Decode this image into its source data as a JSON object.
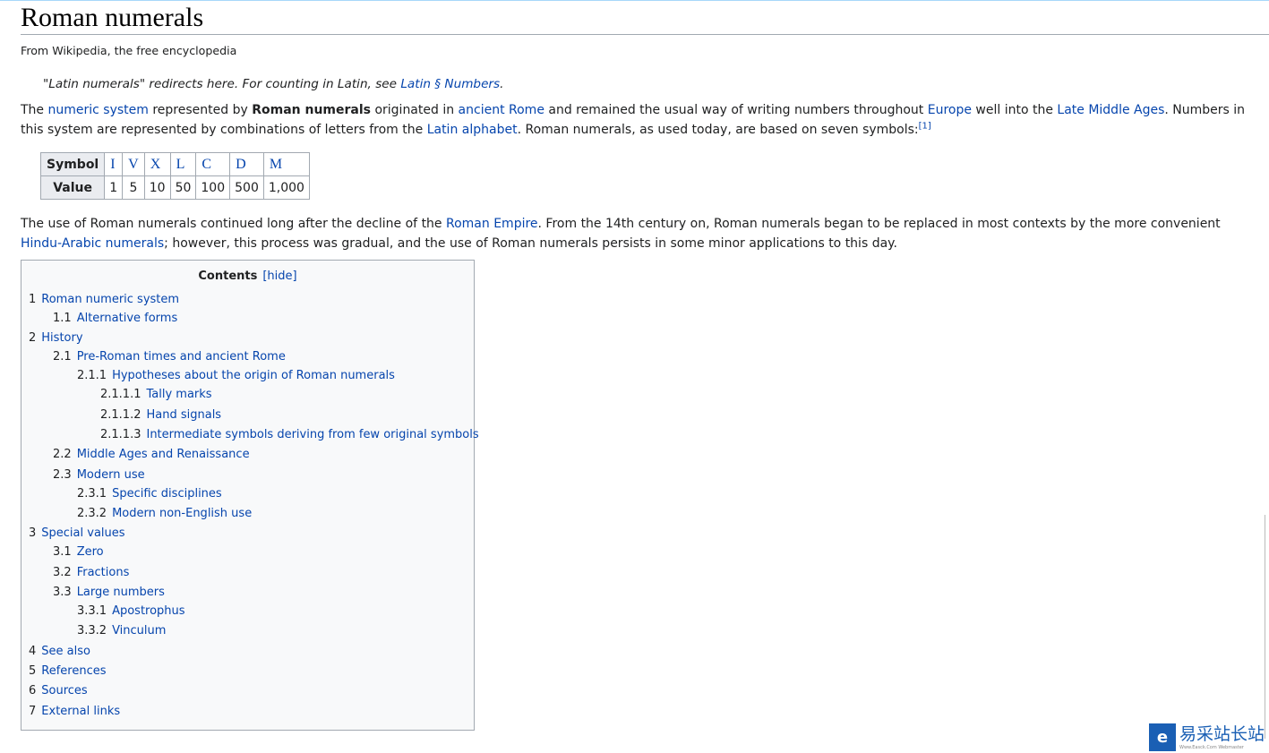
{
  "title": "Roman numerals",
  "tagline": "From Wikipedia, the free encyclopedia",
  "hatnote": {
    "text": "\"Latin numerals\" redirects here. For counting in Latin, see ",
    "link": "Latin § Numbers",
    "end": "."
  },
  "p1": [
    {
      "t": "The "
    },
    {
      "l": "numeric system"
    },
    {
      "t": " represented by "
    },
    {
      "b": "Roman numerals"
    },
    {
      "t": " originated in "
    },
    {
      "l": "ancient Rome"
    },
    {
      "t": " and remained the usual way of writing numbers throughout "
    },
    {
      "l": "Europe"
    },
    {
      "t": " well into the "
    },
    {
      "l": "Late Middle Ages"
    },
    {
      "t": ". Numbers in this system are represented by combinations of letters from the "
    },
    {
      "l": "Latin alphabet"
    },
    {
      "t": ". Roman numerals, as used today, are based on seven symbols:"
    },
    {
      "sup": "[1]"
    }
  ],
  "table": {
    "row_headers": [
      "Symbol",
      "Value"
    ],
    "symbols": [
      "I",
      "V",
      "X",
      "L",
      "C",
      "D",
      "M"
    ],
    "values": [
      "1",
      "5",
      "10",
      "50",
      "100",
      "500",
      "1,000"
    ]
  },
  "p2": [
    {
      "t": "The use of Roman numerals continued long after the decline of the "
    },
    {
      "l": "Roman Empire"
    },
    {
      "t": ". From the 14th century on, Roman numerals began to be replaced in most contexts by the more convenient "
    },
    {
      "l": "Hindu-Arabic numerals"
    },
    {
      "t": "; however, this process was gradual, and the use of Roman numerals persists in some minor applications to this day."
    }
  ],
  "toc": {
    "title": "Contents",
    "hide": "[hide]",
    "items": [
      {
        "n": "1",
        "t": "Roman numeric system",
        "lvl": 1
      },
      {
        "n": "1.1",
        "t": "Alternative forms",
        "lvl": 2
      },
      {
        "n": "2",
        "t": "History",
        "lvl": 1
      },
      {
        "n": "2.1",
        "t": "Pre-Roman times and ancient Rome",
        "lvl": 2
      },
      {
        "n": "2.1.1",
        "t": "Hypotheses about the origin of Roman numerals",
        "lvl": 3
      },
      {
        "n": "2.1.1.1",
        "t": "Tally marks",
        "lvl": 4
      },
      {
        "n": "2.1.1.2",
        "t": "Hand signals",
        "lvl": 4
      },
      {
        "n": "2.1.1.3",
        "t": "Intermediate symbols deriving from few original symbols",
        "lvl": 4
      },
      {
        "n": "2.2",
        "t": "Middle Ages and Renaissance",
        "lvl": 2
      },
      {
        "n": "2.3",
        "t": "Modern use",
        "lvl": 2
      },
      {
        "n": "2.3.1",
        "t": "Specific disciplines",
        "lvl": 3
      },
      {
        "n": "2.3.2",
        "t": "Modern non-English use",
        "lvl": 3
      },
      {
        "n": "3",
        "t": "Special values",
        "lvl": 1
      },
      {
        "n": "3.1",
        "t": "Zero",
        "lvl": 2
      },
      {
        "n": "3.2",
        "t": "Fractions",
        "lvl": 2
      },
      {
        "n": "3.3",
        "t": "Large numbers",
        "lvl": 2
      },
      {
        "n": "3.3.1",
        "t": "Apostrophus",
        "lvl": 3
      },
      {
        "n": "3.3.2",
        "t": "Vinculum",
        "lvl": 3
      },
      {
        "n": "4",
        "t": "See also",
        "lvl": 1
      },
      {
        "n": "5",
        "t": "References",
        "lvl": 1
      },
      {
        "n": "6",
        "t": "Sources",
        "lvl": 1
      },
      {
        "n": "7",
        "t": "External links",
        "lvl": 1
      }
    ]
  },
  "watermark": {
    "text": "易采站长站",
    "sub": "Www.Easck.Com Webmaster"
  },
  "colors": {
    "link": "#0645ad",
    "text": "#202122",
    "border": "#a2a9b1"
  }
}
